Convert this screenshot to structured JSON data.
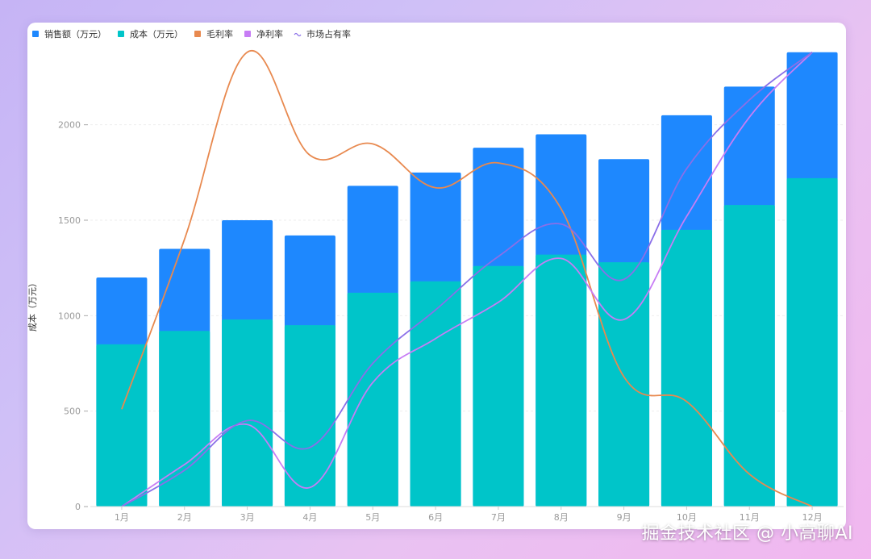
{
  "watermark": "掘金技术社区 @ 小高聊AI",
  "chart_data": {
    "type": "bar",
    "categories": [
      "1月",
      "2月",
      "3月",
      "4月",
      "5月",
      "6月",
      "7月",
      "8月",
      "9月",
      "10月",
      "11月",
      "12月"
    ],
    "ylabel": "成本（万元）",
    "ylim": [
      0,
      2400
    ],
    "yticks": [
      0,
      500,
      1000,
      1500,
      2000
    ],
    "grid": true,
    "legend_position": "top-left",
    "series": [
      {
        "name": "销售额（万元）",
        "kind": "bar",
        "color": "#1e88fe",
        "values": [
          1200,
          1350,
          1500,
          1420,
          1680,
          1750,
          1880,
          1950,
          1820,
          2050,
          2200,
          2380
        ]
      },
      {
        "name": "成本（万元）",
        "kind": "bar",
        "color": "#00c5c9",
        "values": [
          850,
          920,
          980,
          950,
          1120,
          1180,
          1260,
          1320,
          1280,
          1450,
          1580,
          1720
        ]
      },
      {
        "name": "毛利率",
        "kind": "line",
        "color": "#e8894f",
        "values": [
          510,
          1400,
          2380,
          1840,
          1900,
          1670,
          1800,
          1560,
          680,
          550,
          170,
          0
        ]
      },
      {
        "name": "净利率",
        "kind": "line",
        "color": "#c77df5",
        "values": [
          0,
          220,
          430,
          100,
          650,
          880,
          1070,
          1300,
          980,
          1520,
          2040,
          2380
        ]
      },
      {
        "name": "市场占有率",
        "kind": "line",
        "color": "#8a6fe8",
        "values": [
          0,
          190,
          450,
          310,
          750,
          1030,
          1310,
          1480,
          1190,
          1770,
          2130,
          2380
        ]
      }
    ]
  }
}
